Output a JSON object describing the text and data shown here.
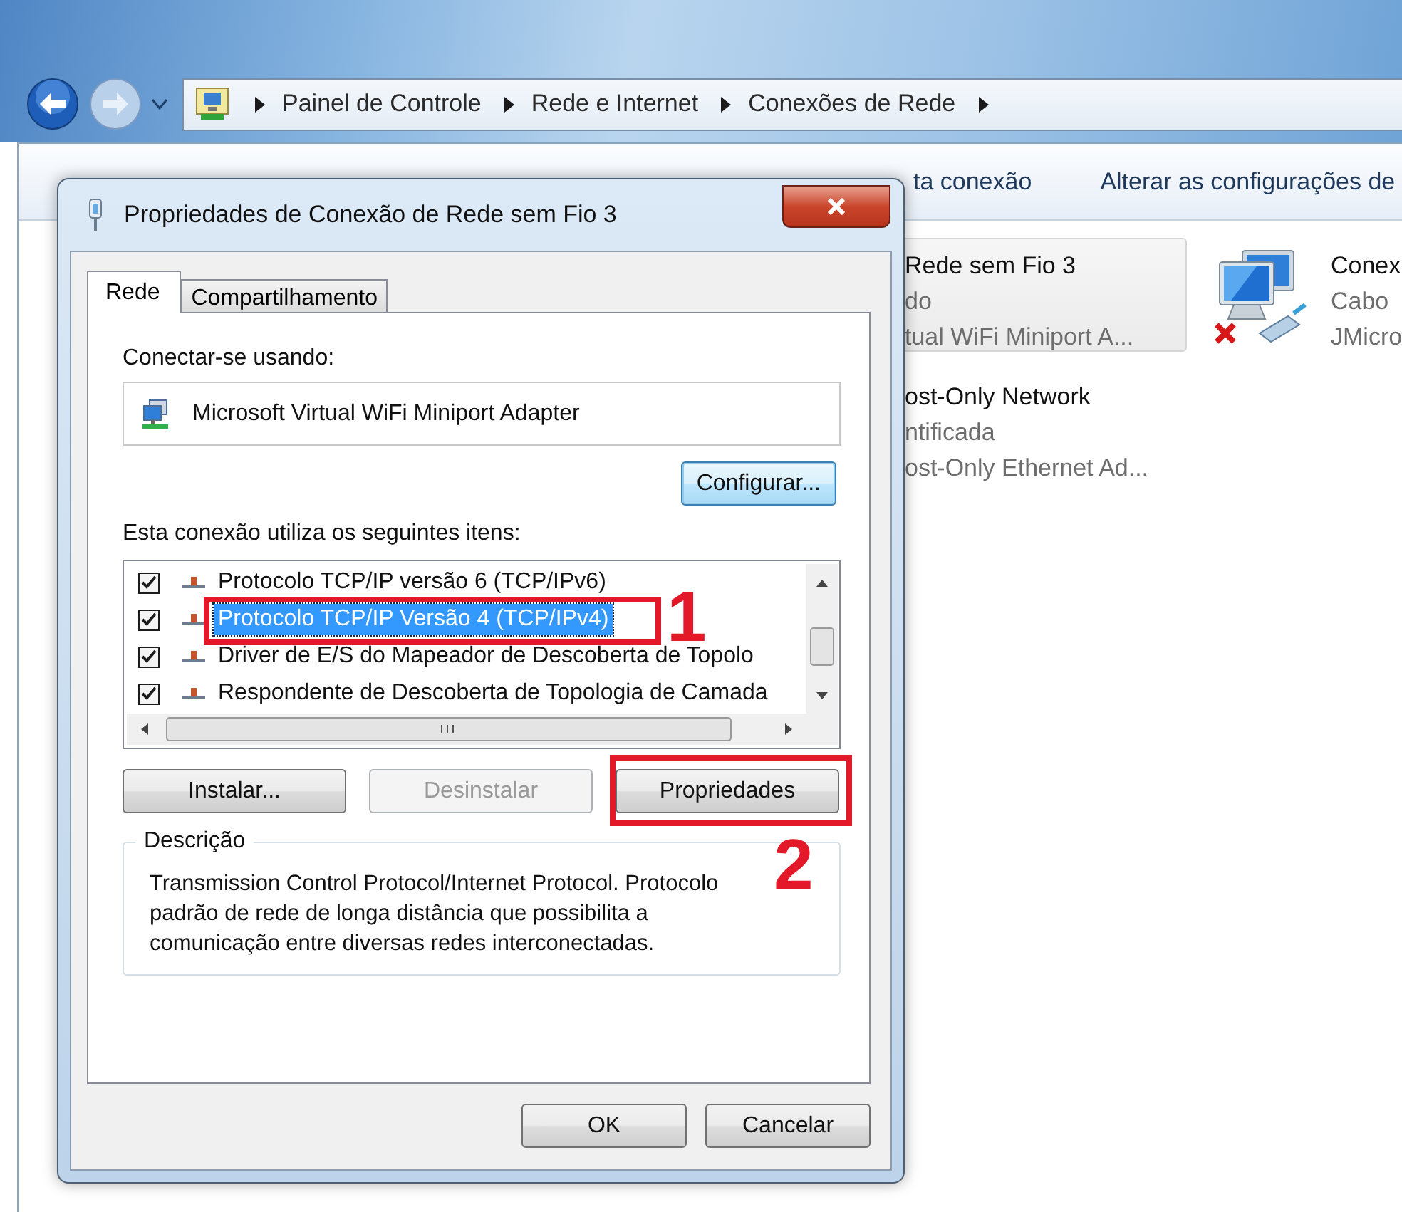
{
  "explorer": {
    "breadcrumb": [
      {
        "label": "Painel de Controle"
      },
      {
        "label": "Rede e Internet"
      },
      {
        "label": "Conexões de Rede"
      }
    ],
    "toolbar": [
      {
        "label": "ta conexão"
      },
      {
        "label": "Alterar as configurações de"
      }
    ],
    "connections": [
      {
        "name": "Rede sem Fio 3",
        "status": "do",
        "device": "tual WiFi Miniport A...",
        "selected": true,
        "kind": "covered"
      },
      {
        "name": "Conex",
        "status": "Cabo",
        "device": "JMicro",
        "selected": false,
        "kind": "disconnected"
      },
      {
        "name": "ost-Only Network",
        "status": "ntificada",
        "device": "ost-Only Ethernet Ad...",
        "selected": false,
        "kind": "covered"
      }
    ]
  },
  "dialog": {
    "title": "Propriedades de Conexão de Rede sem Fio 3",
    "tabs": [
      {
        "label": "Rede",
        "selected": true
      },
      {
        "label": "Compartilhamento",
        "selected": false
      }
    ],
    "connect_label": "Conectar-se usando:",
    "adapter": "Microsoft Virtual WiFi Miniport Adapter",
    "configure_button": "Configurar...",
    "items_label": "Esta conexão utiliza os seguintes itens:",
    "items": [
      {
        "label": "Protocolo TCP/IP versão 6 (TCP/IPv6)",
        "checked": true,
        "selected": false
      },
      {
        "label": "Protocolo TCP/IP Versão 4 (TCP/IPv4)",
        "checked": true,
        "selected": true
      },
      {
        "label": "Driver de E/S do Mapeador de Descoberta de Topolo",
        "checked": true,
        "selected": false
      },
      {
        "label": "Respondente de Descoberta de Topologia de Camada",
        "checked": true,
        "selected": false
      }
    ],
    "buttons": [
      {
        "label": "Instalar...",
        "disabled": false
      },
      {
        "label": "Desinstalar",
        "disabled": true
      },
      {
        "label": "Propriedades",
        "disabled": false
      }
    ],
    "description": {
      "title": "Descrição",
      "text": "Transmission Control Protocol/Internet Protocol. Protocolo padrão de rede de longa distância que possibilita a comunicação entre diversas redes interconectadas."
    },
    "footer_buttons": [
      {
        "label": "OK"
      },
      {
        "label": "Cancelar"
      }
    ]
  },
  "annotations": [
    {
      "label": "1"
    },
    {
      "label": "2"
    }
  ]
}
